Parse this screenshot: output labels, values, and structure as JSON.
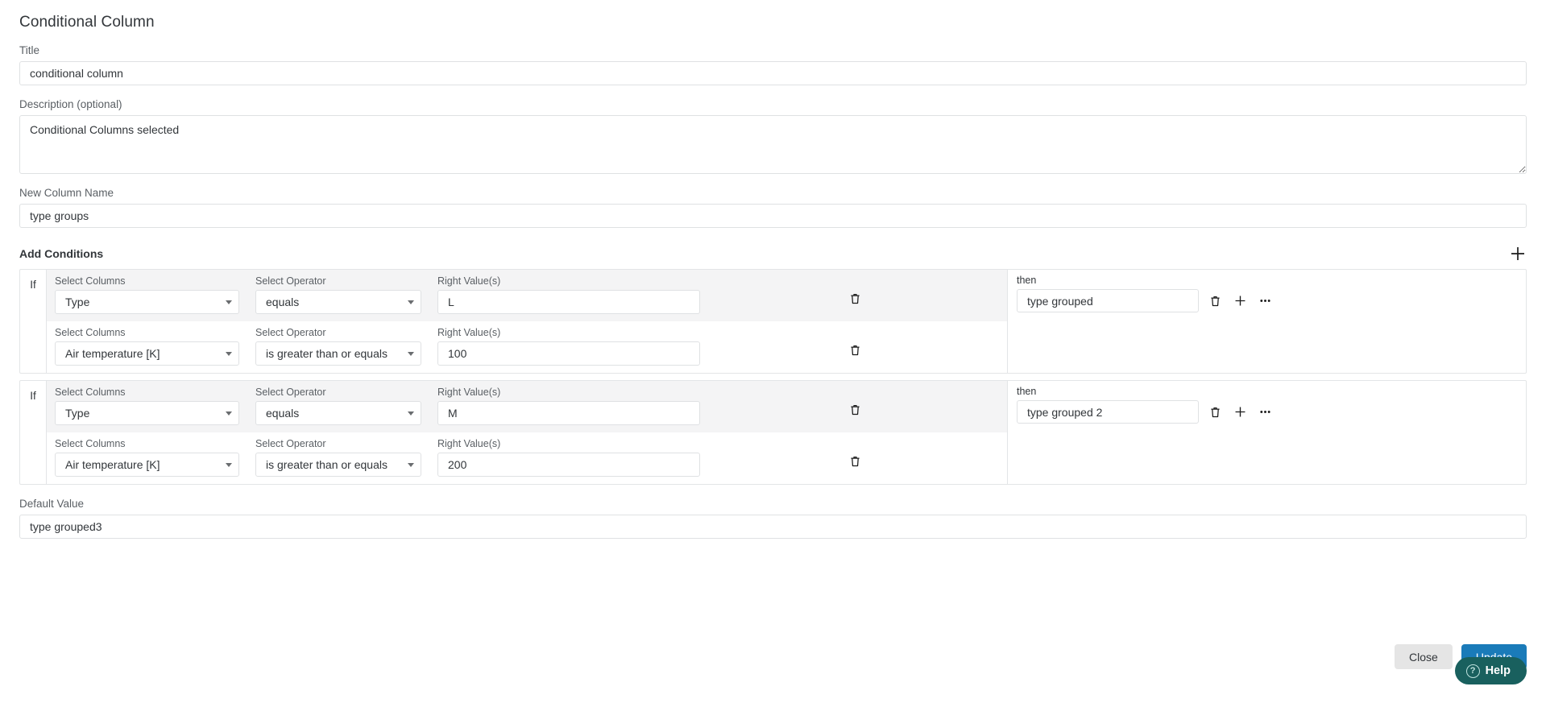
{
  "dialog": {
    "title": "Conditional Column"
  },
  "form": {
    "title_label": "Title",
    "title_value": "conditional column",
    "title_placeholder": "",
    "description_label": "Description (optional)",
    "description_value": "Conditional Columns selected",
    "description_placeholder": "",
    "new_column_label": "New Column Name",
    "new_column_value": "type groups",
    "new_column_placeholder": "",
    "default_value_label": "Default Value",
    "default_value_value": "type grouped3",
    "default_value_placeholder": ""
  },
  "conditions_section": {
    "heading": "Add Conditions",
    "add_icon": "plus-icon"
  },
  "labels": {
    "if": "If",
    "then": "then",
    "select_columns": "Select Columns",
    "select_operator": "Select Operator",
    "right_values": "Right Value(s)"
  },
  "icons": {
    "trash": "trash-icon",
    "plus": "plus-icon",
    "ellipsis": "ellipsis-icon",
    "caret": "chevron-down-icon",
    "help": "question-circle-icon"
  },
  "condition_groups": [
    {
      "then_label": "then",
      "then_value": "type grouped",
      "rows": [
        {
          "column": "Type",
          "operator": "equals",
          "value": "L",
          "shaded": true
        },
        {
          "column": "Air temperature [K]",
          "operator": "is greater than or equals",
          "value": "100",
          "shaded": false
        }
      ]
    },
    {
      "then_label": "then",
      "then_value": "type grouped 2",
      "rows": [
        {
          "column": "Type",
          "operator": "equals",
          "value": "M",
          "shaded": true
        },
        {
          "column": "Air temperature [K]",
          "operator": "is greater than or equals",
          "value": "200",
          "shaded": false
        }
      ]
    }
  ],
  "footer": {
    "close_label": "Close",
    "update_label": "Update"
  },
  "help_widget": {
    "label": "Help",
    "glyph": "?"
  },
  "colors": {
    "primary": "#1a7bb9",
    "help_bg": "#19605e",
    "row_shade": "#f4f4f5",
    "border": "#dfe1e3"
  }
}
